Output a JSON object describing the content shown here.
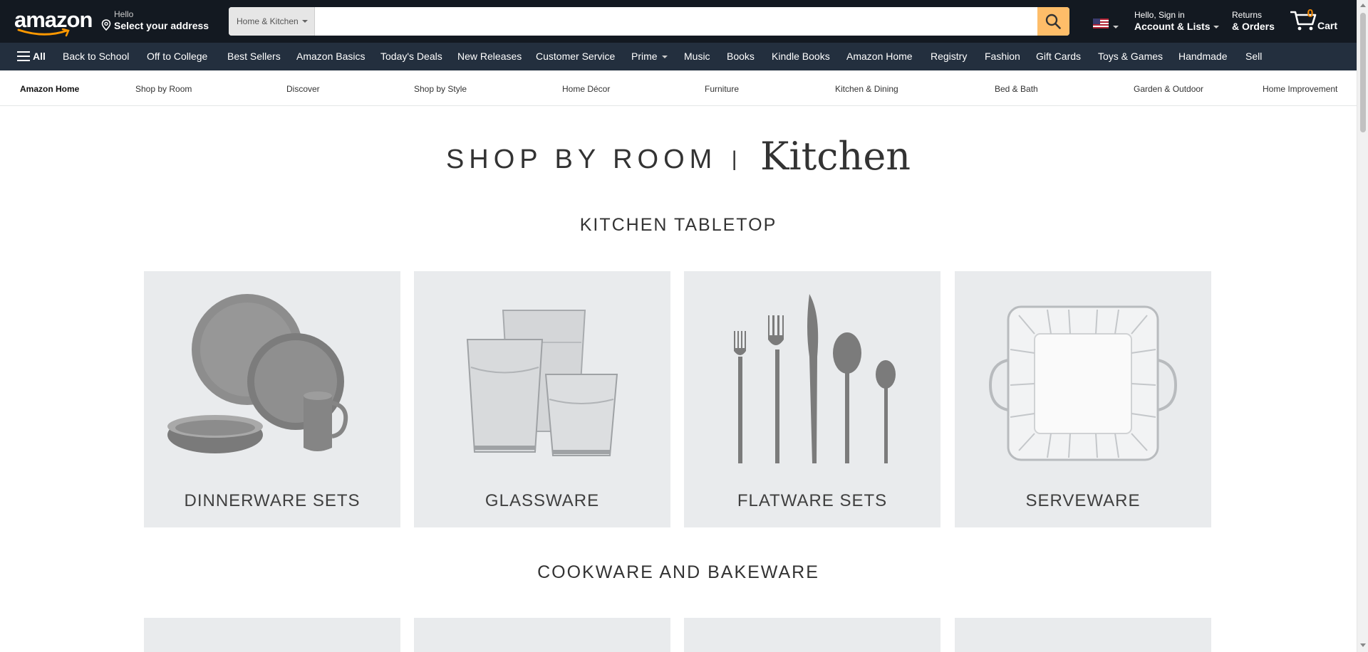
{
  "header": {
    "logo_text": "amazon",
    "address_line1": "Hello",
    "address_line2": "Select your address",
    "search_department": "Home & Kitchen",
    "search_placeholder": "",
    "account_line1": "Hello, Sign in",
    "account_line2": "Account & Lists",
    "returns_line1": "Returns",
    "returns_line2": "& Orders",
    "cart_count": "0",
    "cart_label": "Cart"
  },
  "nav": {
    "all_label": "All",
    "items": [
      "Back to School",
      "Off to College",
      "Best Sellers",
      "Amazon Basics",
      "Today's Deals",
      "New Releases",
      "Customer Service",
      "Prime",
      "Music",
      "Books",
      "Kindle Books",
      "Amazon Home",
      "Registry",
      "Fashion",
      "Gift Cards",
      "Toys & Games",
      "Handmade",
      "Sell"
    ]
  },
  "subnav": {
    "items": [
      "Amazon Home",
      "Shop by Room",
      "Discover",
      "Shop by Style",
      "Home Décor",
      "Furniture",
      "Kitchen & Dining",
      "Bed & Bath",
      "Garden & Outdoor",
      "Home Improvement"
    ]
  },
  "main": {
    "title_prefix": "SHOP BY ROOM",
    "title_separator": "|",
    "title_room": "Kitchen",
    "sections": [
      {
        "title": "KITCHEN TABLETOP",
        "tiles": [
          "DINNERWARE SETS",
          "GLASSWARE",
          "FLATWARE SETS",
          "SERVEWARE"
        ]
      },
      {
        "title": "COOKWARE AND BAKEWARE",
        "tiles": [
          "",
          "",
          "",
          ""
        ]
      }
    ]
  },
  "colors": {
    "header_bg": "#131921",
    "nav_bg": "#232f3e",
    "search_button": "#febd69",
    "cart_count": "#f08804",
    "tile_bg": "#e9ebed"
  }
}
